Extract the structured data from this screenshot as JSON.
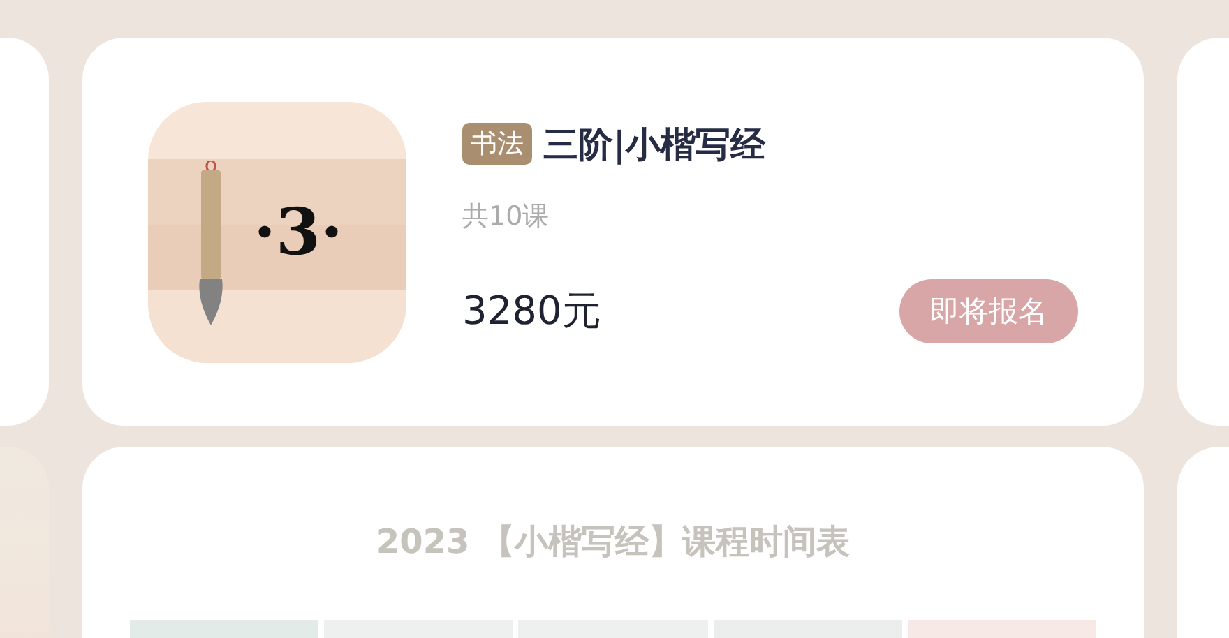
{
  "course_card": {
    "cover_mark": "·3·",
    "tag": "书法",
    "title": "三阶|小楷写经",
    "lesson_count": "共10课",
    "price": "3280元",
    "signup_button": "即将报名"
  },
  "schedule_card": {
    "title": "2023 【小楷写经】课程时间表",
    "header_cells": [
      {
        "color": "#e3ebe8"
      },
      {
        "color": "#eef0ef"
      },
      {
        "color": "#eef0ef"
      },
      {
        "color": "#eceeed"
      },
      {
        "color": "#f6e9e6"
      }
    ]
  }
}
